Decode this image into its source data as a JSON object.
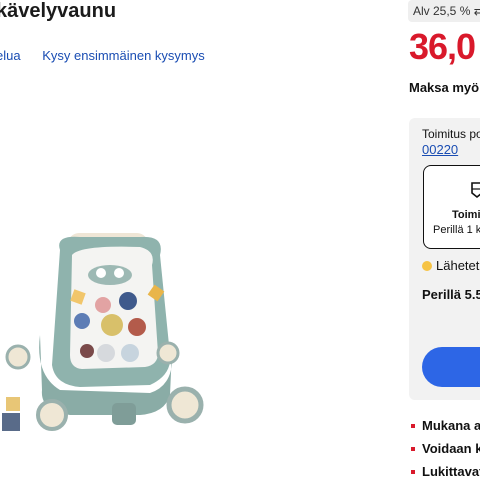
{
  "product": {
    "title": "kävelyvaunu",
    "links": [
      "elua",
      "Kysy ensimmäinen kysymys"
    ]
  },
  "sidebar": {
    "vat_badge": "Alv 25,5 %",
    "price": "36,0",
    "pay_later": "Maksa myöh",
    "shipping_label": "Toimitus pos",
    "postal_code": "00220",
    "delivery_title": "Toimi",
    "delivery_sub": "Perillä 1 k",
    "sent_text": "Lähetet",
    "arrival_text": "Perillä 5.5",
    "features": [
      "Mukana a",
      "Voidaan k",
      "Lukittavat"
    ]
  },
  "colors": {
    "price": "#d9192b",
    "link": "#1a4db3",
    "cta": "#2d66e6",
    "status_dot": "#f6c344"
  },
  "icons": [
    "swap-arrows-icon",
    "delivery-box-icon"
  ]
}
